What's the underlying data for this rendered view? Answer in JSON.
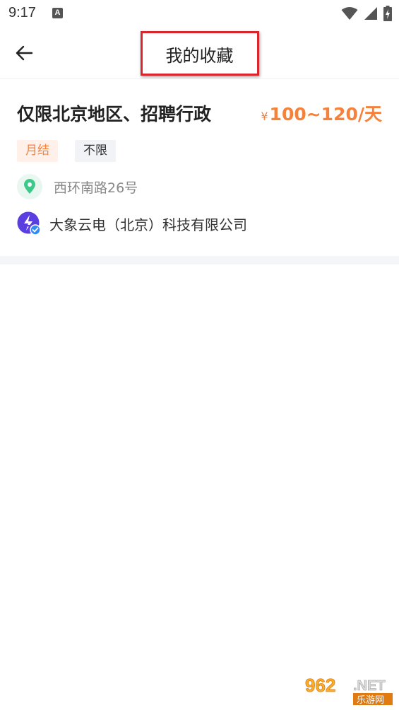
{
  "status_bar": {
    "time": "9:17",
    "notification_letter": "A",
    "icons": [
      "wifi-icon",
      "signal-icon",
      "battery-charging-icon"
    ]
  },
  "header": {
    "back_icon": "arrow-left-icon",
    "title": "我的收藏"
  },
  "job": {
    "title": "仅限北京地区、招聘行政",
    "salary_currency": "¥",
    "salary": "100~120/天",
    "tags": [
      "月结",
      "不限"
    ],
    "address_icon": "location-pin-icon",
    "address": "西环南路26号",
    "company_logo": "company-logo-verified-icon",
    "company": "大象云电（北京）科技有限公司"
  },
  "watermark": {
    "top": "962",
    "suffix": ".NET",
    "bottom": "乐游网"
  },
  "colors": {
    "accent_orange": "#f5813b",
    "tag_orange_bg": "#fff1ea",
    "tag_gray_bg": "#f2f3f7",
    "location_green": "#3dc98a",
    "logo_purple": "#5b3ee0",
    "verified_blue": "#2f8cf4",
    "highlight_red": "#d9262c"
  }
}
